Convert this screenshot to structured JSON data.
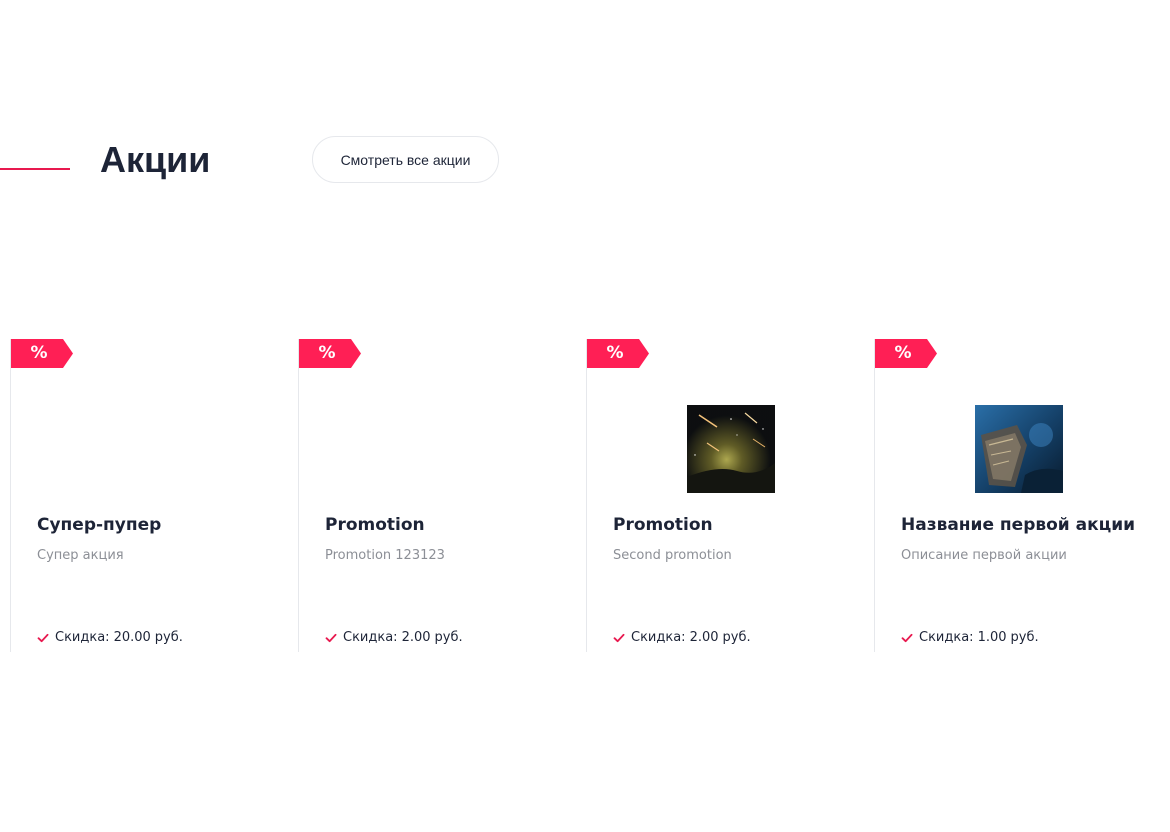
{
  "section": {
    "title": "Акции",
    "all_button_label": "Смотреть все акции",
    "accent_color": "#e8194f"
  },
  "badge": {
    "symbol": "%",
    "color": "#ff1f55"
  },
  "discount_label": "Скидка:",
  "currency": "руб.",
  "cards": [
    {
      "title": "Супер-пупер",
      "description": "Супер акция",
      "discount": "20.00",
      "image": ""
    },
    {
      "title": "Promotion",
      "description": "Promotion 123123",
      "discount": "2.00",
      "image": ""
    },
    {
      "title": "Promotion",
      "description": "Second promotion",
      "discount": "2.00",
      "image": "night-sky-meteors-image"
    },
    {
      "title": "Название первой акции",
      "description": "Описание первой акции",
      "discount": "1.00",
      "image": "shipwreck-underwater-image"
    }
  ]
}
